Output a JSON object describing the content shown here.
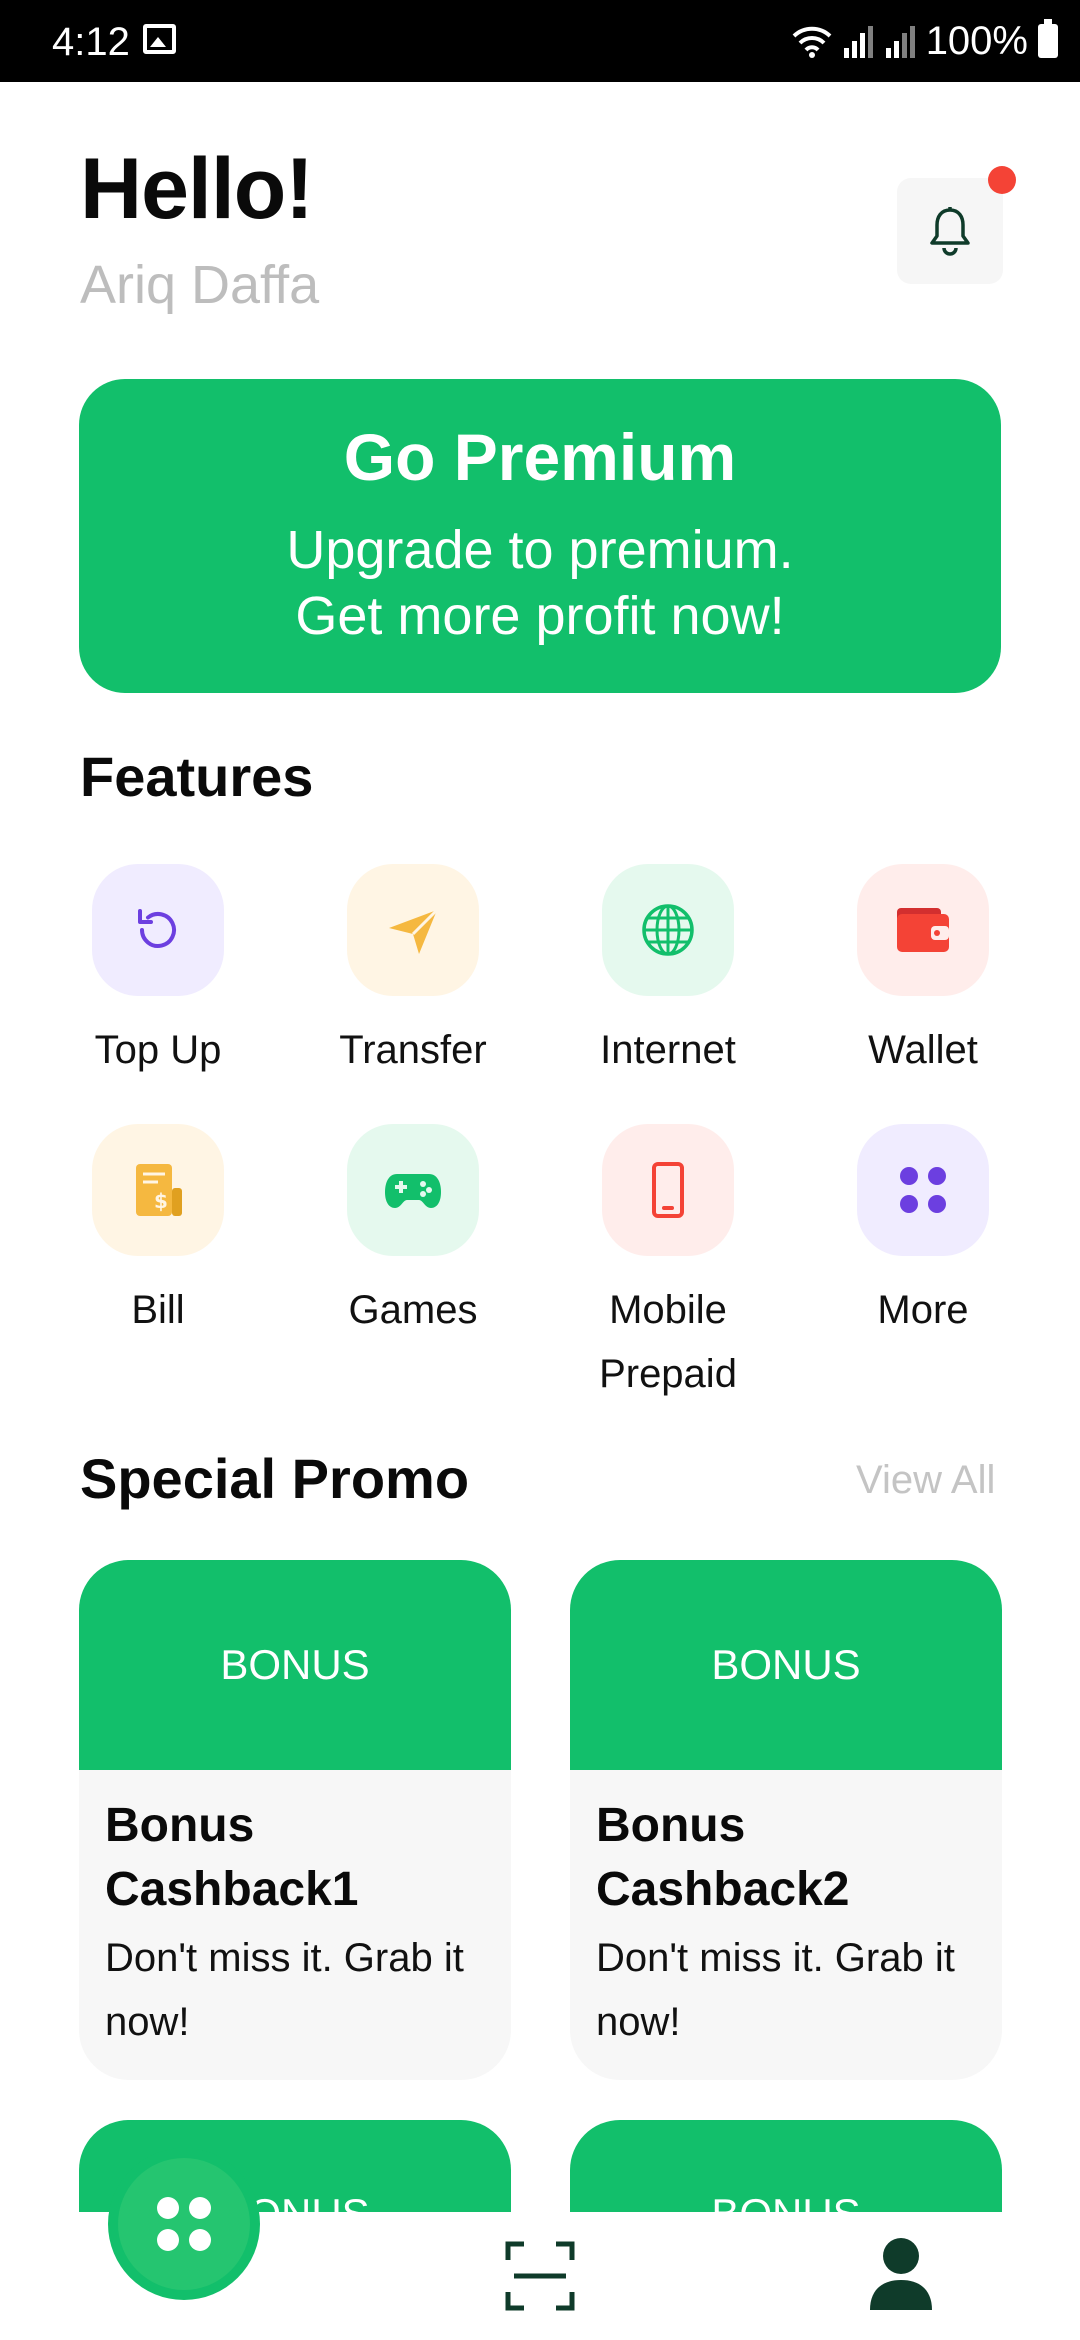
{
  "status_bar": {
    "time": "4:12",
    "battery": "100%"
  },
  "header": {
    "greeting": "Hello!",
    "user_name": "Ariq Daffa"
  },
  "premium": {
    "title": "Go Premium",
    "line1": "Upgrade to premium.",
    "line2": "Get more profit now!"
  },
  "features": {
    "title": "Features",
    "items": [
      {
        "label": "Top Up",
        "icon": "refresh-icon",
        "bg": "#f0ecff",
        "color": "#6c3fe0"
      },
      {
        "label": "Transfer",
        "icon": "send-icon",
        "bg": "#fff5e4",
        "color": "#f5b840"
      },
      {
        "label": "Internet",
        "icon": "globe-icon",
        "bg": "#e5f9ee",
        "color": "#12bf6b"
      },
      {
        "label": "Wallet",
        "icon": "wallet-icon",
        "bg": "#ffedeb",
        "color": "#f44336"
      },
      {
        "label": "Bill",
        "icon": "bill-icon",
        "bg": "#fff5e4",
        "color": "#f5b840"
      },
      {
        "label": "Games",
        "icon": "gamepad-icon",
        "bg": "#e5f9ee",
        "color": "#12bf6b"
      },
      {
        "label": "Mobile\nPrepaid",
        "icon": "phone-icon",
        "bg": "#ffedeb",
        "color": "#f44336"
      },
      {
        "label": "More",
        "icon": "grid-icon",
        "bg": "#f0ecff",
        "color": "#6c3fe0"
      }
    ]
  },
  "promo": {
    "title": "Special Promo",
    "view_all": "View All",
    "cards": [
      {
        "badge": "BONUS",
        "title": "Bonus Cashback1",
        "desc": "Don't miss it. Grab it now!"
      },
      {
        "badge": "BONUS",
        "title": "Bonus Cashback2",
        "desc": "Don't miss it. Grab it now!"
      },
      {
        "badge": "BONUS"
      },
      {
        "badge": "BONUS"
      }
    ]
  },
  "colors": {
    "accent": "#12bf6b",
    "dark_green": "#0f3b2a",
    "notification": "#f44336"
  }
}
